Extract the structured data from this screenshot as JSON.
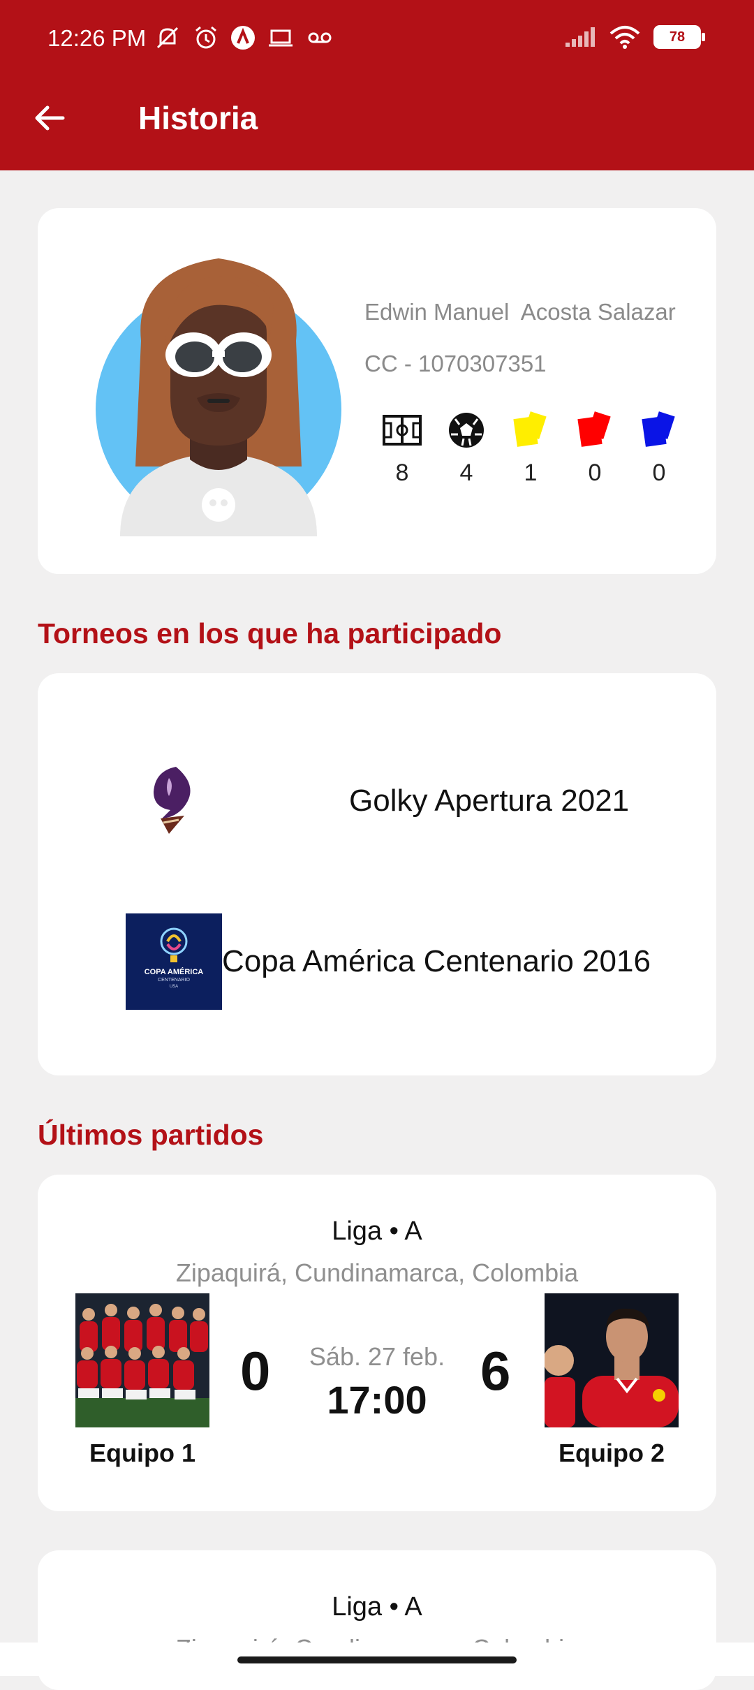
{
  "status": {
    "time": "12:26 PM",
    "battery": "78"
  },
  "header": {
    "title": "Historia"
  },
  "profile": {
    "name": "Edwin Manuel  Acosta Salazar",
    "id": "CC - 1070307351",
    "stats": [
      {
        "icon": "field-icon",
        "value": "8"
      },
      {
        "icon": "soccer-ball-icon",
        "value": "4"
      },
      {
        "icon": "yellow-card-icon",
        "value": "1",
        "color": "#ffee00"
      },
      {
        "icon": "red-card-icon",
        "value": "0",
        "color": "#ff0000"
      },
      {
        "icon": "blue-card-icon",
        "value": "0",
        "color": "#0a14e6"
      }
    ]
  },
  "tournaments": {
    "title": "Torneos en los que ha participado",
    "items": [
      {
        "name": "Golky Apertura 2021"
      },
      {
        "name": "Copa América Centenario 2016",
        "logo_text": "COPA AMÉRICA",
        "logo_sub": "CENTENARIO",
        "logo_usa": "USA"
      }
    ]
  },
  "matches": {
    "title": "Últimos partidos",
    "items": [
      {
        "league": "Liga • A",
        "location": "Zipaquirá, Cundinamarca, Colombia",
        "date": "Sáb. 27 feb.",
        "time": "17:00",
        "home": {
          "name": "Equipo 1",
          "score": "0"
        },
        "away": {
          "name": "Equipo 2",
          "score": "6"
        }
      },
      {
        "league": "Liga • A",
        "location": "Zipaquirá, Cundinamarca, Colombia"
      }
    ]
  },
  "colors": {
    "brand": "#b31117",
    "background": "#f1f0f0"
  }
}
